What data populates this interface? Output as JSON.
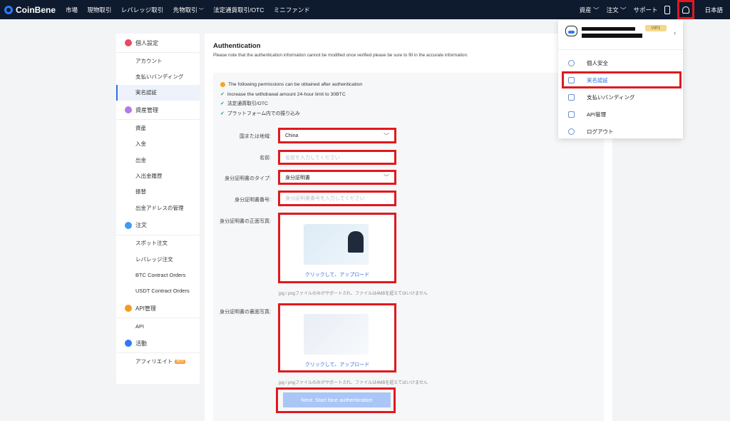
{
  "header": {
    "logo": "CoinBene",
    "nav": [
      {
        "label": "市場",
        "caret": false
      },
      {
        "label": "現物取引",
        "caret": false
      },
      {
        "label": "レバレッジ取引",
        "caret": false
      },
      {
        "label": "先物取引",
        "caret": true
      },
      {
        "label": "法定通貨取引/OTC",
        "caret": false
      },
      {
        "label": "ミニファンド",
        "caret": false
      }
    ],
    "right": {
      "assets": "資産",
      "orders": "注文",
      "support": "サポート",
      "language": "日本語"
    }
  },
  "sidebar": {
    "groups": [
      {
        "title": "個人設定",
        "color": "#e84a5f",
        "items": [
          "アカウント",
          "支払いバンディング",
          "実名認証"
        ]
      },
      {
        "title": "資産管理",
        "color": "#b07be6",
        "items": [
          "資産",
          "入金",
          "出金",
          "入出金履歴",
          "振替",
          "出金アドレスの管理"
        ]
      },
      {
        "title": "注文",
        "color": "#3d9cf0",
        "items": [
          "スポット注文",
          "レバレッジ注文",
          "BTC Contract Orders",
          "USDT Contract Orders"
        ]
      },
      {
        "title": "API管理",
        "color": "#f59a23",
        "items": [
          "API"
        ]
      },
      {
        "title": "活動",
        "color": "#2f78ff",
        "items": [
          "アフィリエイト"
        ]
      }
    ],
    "active_item": "実名認証",
    "hot_badge": "HOT"
  },
  "auth": {
    "title": "Authentication",
    "notice": "Please note that the authentication information cannot be modified once verified please be sure to fill in the accurate information.",
    "permissions_title": "The following permissions can be obtained after authentication",
    "permissions": [
      "Increase the withdrawal amount 24-hour limit to 30BTC",
      "法定通貨取引/OTC",
      "プラットフォーム内での振り込み"
    ],
    "country_label": "国または地域:",
    "country_value": "China",
    "name_label": "名前:",
    "name_placeholder": "名前を入力してください",
    "id_type_label": "身分証明書のタイプ:",
    "id_type_value": "身分証明書",
    "id_number_label": "身分証明書番号:",
    "id_number_placeholder": "身分証明書番号を入力してください",
    "front_label": "身分証明書の正面写真:",
    "back_label": "身分証明書の裏面写真:",
    "upload_text": "クリックして、アップロード",
    "upload_hint": "jpg / pngファイルのみがサポートされ、ファイルは4MBを超えてはいけません",
    "next_button": "Next: Start face authentication"
  },
  "user_menu": {
    "vip": "VIP1",
    "items": [
      {
        "label": "個人安全",
        "icon": "user-icon"
      },
      {
        "label": "実名認証",
        "icon": "id-card-icon"
      },
      {
        "label": "支払いバンディング",
        "icon": "card-icon"
      },
      {
        "label": "API管理",
        "icon": "monitor-icon"
      },
      {
        "label": "ログアウト",
        "icon": "power-icon"
      }
    ]
  }
}
